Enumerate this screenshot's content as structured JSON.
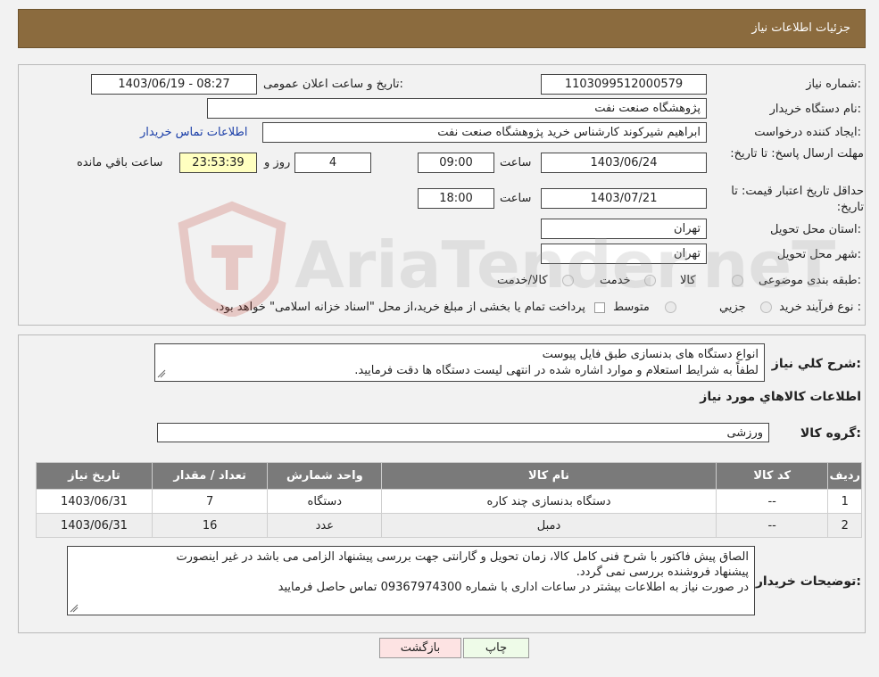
{
  "header": {
    "title": "جزئیات اطلاعات نیاز"
  },
  "form": {
    "need_number_label": "شماره نیاز:",
    "need_number": "1103099512000579",
    "announce_label": "تاریخ و ساعت اعلان عمومی:",
    "announce_value": "1403/06/19 - 08:27",
    "buyer_org_label": "نام دستگاه خریدار:",
    "buyer_org": "پژوهشگاه صنعت نفت",
    "requester_label": "ایجاد کننده درخواست:",
    "requester": "ابراهیم شیرکوند کارشناس خرید پژوهشگاه صنعت نفت",
    "contact_link": "اطلاعات تماس خریدار",
    "deadline_label": "مهلت ارسال پاسخ: تا تاریخ:",
    "deadline_date": "1403/06/24",
    "time_label": "ساعت",
    "deadline_time": "09:00",
    "days_value": "4",
    "days_label": "روز و",
    "remaining_time": "23:53:39",
    "remaining_label": "ساعت باقي مانده",
    "validity_label": "حداقل تاریخ اعتبار قیمت: تا تاریخ:",
    "validity_date": "1403/07/21",
    "validity_time": "18:00",
    "province_label": "استان محل تحویل:",
    "province": "تهران",
    "city_label": "شهر محل تحویل:",
    "city": "تهران",
    "category_label": "طبقه بندی موضوعی:",
    "category_options": [
      "کالا",
      "خدمت",
      "کالا/خدمت"
    ],
    "process_label": "نوع فرآیند خرید :",
    "process_options": [
      "جزیي",
      "متوسط"
    ],
    "process_note": "پرداخت تمام یا بخشی از مبلغ خرید،از محل \"اسناد خزانه اسلامی\" خواهد بود."
  },
  "description": {
    "label": "شرح کلي نياز:",
    "line1": "انواع دستگاه های بدنسازی طبق فایل پیوست",
    "line2": "لطفاً به شرایط استعلام و موارد اشاره شده در انتهی لیست دستگاه ها دقت فرمایید."
  },
  "goods": {
    "section_title": "اطلاعات کالاهاي مورد نياز",
    "group_label": "گروه کالا:",
    "group_value": "ورزشی",
    "columns": [
      "رديف",
      "کد کالا",
      "نام کالا",
      "واحد شمارش",
      "تعداد / مقدار",
      "تاریخ نیاز"
    ],
    "rows": [
      {
        "idx": "1",
        "code": "--",
        "name": "دستگاه بدنسازی چند کاره",
        "unit": "دستگاه",
        "qty": "7",
        "date": "1403/06/31"
      },
      {
        "idx": "2",
        "code": "--",
        "name": "دمبل",
        "unit": "عدد",
        "qty": "16",
        "date": "1403/06/31"
      }
    ]
  },
  "notes": {
    "label": "توضیحات خریدار:",
    "line1": "الصاق پیش فاکتور با شرح فنی کامل کالا، زمان تحویل و گارانتی جهت بررسی پیشنهاد الزامی می باشد در غیر اینصورت",
    "line2": "پیشنهاد فروشنده بررسی نمی گردد.",
    "line3": "در صورت نیاز به اطلاعات بیشتر در ساعات اداری با شماره 09367974300 تماس حاصل فرمایید"
  },
  "buttons": {
    "print": "چاپ",
    "back": "بازگشت"
  },
  "watermark": {
    "text": "AriaTender.neT"
  },
  "colors": {
    "header": "#8b6b3e",
    "table_header": "#7a7a7a",
    "link": "#1a3ea8",
    "remaining_bg": "#ffffc0",
    "back_btn": "#fde3e3",
    "print_btn": "#eefbe8"
  }
}
